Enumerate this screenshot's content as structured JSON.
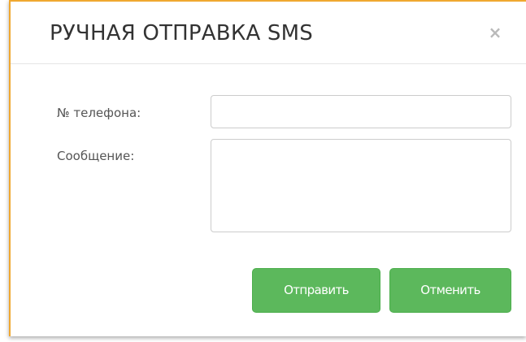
{
  "dialog": {
    "title": "РУЧНАЯ ОТПРАВКА SMS",
    "close_icon": "close-icon",
    "close_glyph": "×"
  },
  "form": {
    "phone_label": "№ телефона:",
    "phone_value": "",
    "message_label": "Сообщение:",
    "message_value": ""
  },
  "buttons": {
    "send_label": "Отправить",
    "cancel_label": "Отменить"
  },
  "colors": {
    "button_bg": "#5cb85c",
    "accent_border": "#f0a830",
    "title_text": "#333333",
    "label_text": "#555555"
  }
}
